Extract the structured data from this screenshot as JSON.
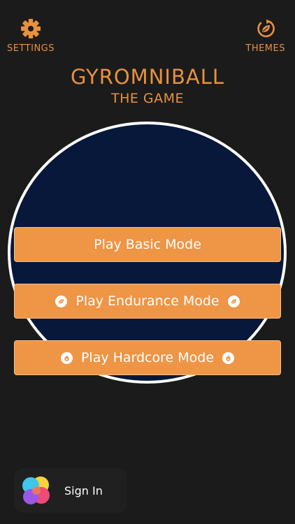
{
  "header": {
    "settings_label": "SETTINGS",
    "settings_icon": "gear-icon",
    "themes_label": "THEMES",
    "themes_icon": "refresh-leaf-icon"
  },
  "title": {
    "main": "GYROMNIBALL",
    "sub": "THE GAME"
  },
  "menu": {
    "basic_label": "Play Basic Mode",
    "endurance_label": "Play Endurance Mode",
    "endurance_icon": "leaf-badge-icon",
    "hardcore_label": "Play Hardcore Mode",
    "hardcore_icon": "flame-badge-icon"
  },
  "game_center": {
    "signin_label": "Sign In",
    "logo_icon": "game-center-bubbles-icon"
  },
  "colors": {
    "accent": "#e8913f",
    "button_fill": "#ee9546",
    "background": "#1b1b1b",
    "circle_fill": "#07183a"
  }
}
